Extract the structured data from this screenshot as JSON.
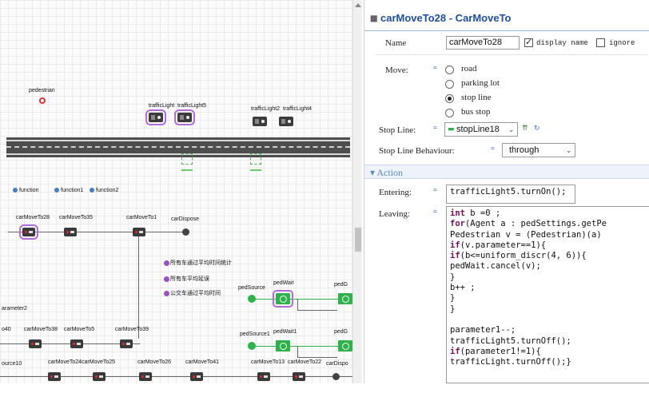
{
  "canvas": {
    "pedestrian_label": "pedestrian",
    "traffic_labels": [
      "trafficLight",
      "trafficLight5",
      "trafficLight2",
      "trafficLight4"
    ],
    "functions": [
      "function",
      "function1",
      "function2"
    ],
    "blocks_row1": [
      "carMoveTo28",
      "carMoveTo35",
      "carMoveTo1",
      "carDispose"
    ],
    "stats": [
      "所有车通过平均时间统计",
      "所有车平均延误",
      "公交车通过平均时间"
    ],
    "ped_labels": [
      "pedSource",
      "pedWait",
      "pedG"
    ],
    "ped_labels2": [
      "pedSource1",
      "pedWait1",
      "pedG"
    ],
    "parameter_label": "arameter2",
    "blocks_row2": [
      "o40",
      "carMoveTo38",
      "carMoveTo5",
      "carMoveTo39"
    ],
    "blocks_row3": [
      "ource10",
      "carMoveTo24",
      "carMoveTo25",
      "carMoveTo26",
      "carMoveTo41",
      "carMoveTo13",
      "carMoveTo22",
      "carDispo"
    ]
  },
  "props": {
    "title": "carMoveTo28 - CarMoveTo",
    "name_label": "Name",
    "name_value": "carMoveTo28",
    "display_name_label": "display name",
    "display_name_checked": true,
    "ignore_label": "ignore",
    "ignore_checked": false,
    "move_label": "Move:",
    "move_options": [
      "road",
      "parking lot",
      "stop line",
      "bus stop"
    ],
    "move_selected": "stop line",
    "stop_line_label": "Stop Line:",
    "stop_line_value": "stopLine18",
    "stop_line_behaviour_label": "Stop Line Behaviour:",
    "stop_line_behaviour_value": "through",
    "action_section": "Action",
    "entering_label": "Entering:",
    "entering_code": "trafficLight5.turnOn();",
    "leaving_label": "Leaving:",
    "leaving_code": [
      "int b =0 ;",
      "for(Agent a : pedSettings.getPe",
      "Pedestrian v = (Pedestrian)(a)",
      "if(v.parameter==1){",
      "if(b<=uniform_discr(4, 6)){",
      "pedWait.cancel(v);",
      "}",
      "b++ ;",
      "}",
      "}",
      "",
      "parameter1--;",
      "trafficLight5.turnOff();",
      "if(parameter1!=1){",
      "trafficLight.turnOff();}"
    ]
  },
  "colors": {
    "title_blue": "#1f4fa0",
    "section_blue": "#5b87c5",
    "selection_purple": "#b26bd8",
    "green_block": "#2db34a"
  }
}
